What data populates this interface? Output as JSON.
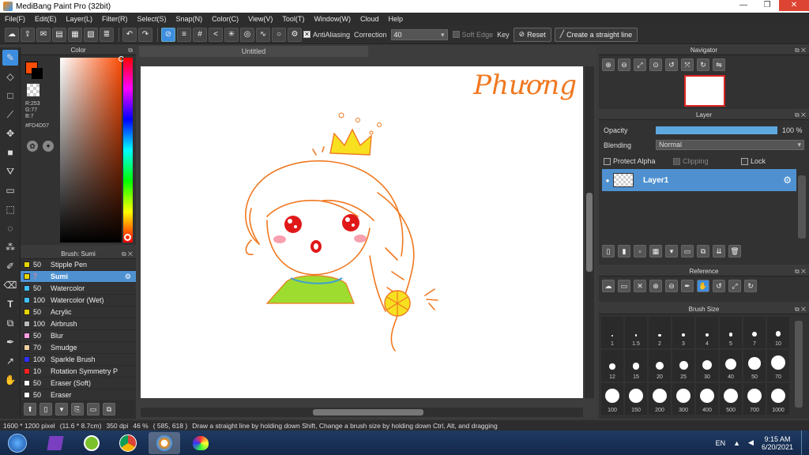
{
  "window": {
    "title": "MediBang Paint Pro (32bit)",
    "min": "—",
    "max": "❐",
    "close": "✕"
  },
  "menu": [
    "File(F)",
    "Edit(E)",
    "Layer(L)",
    "Filter(R)",
    "Select(S)",
    "Snap(N)",
    "Color(C)",
    "View(V)",
    "Tool(T)",
    "Window(W)",
    "Cloud",
    "Help"
  ],
  "toolbar": {
    "antialiasing": "AntiAliasing",
    "correction_label": "Correction",
    "correction_value": "40",
    "soft_edge": "Soft Edge",
    "key": "Key",
    "reset": "Reset",
    "straight_line": "Create a straight line"
  },
  "color_panel": {
    "title": "Color",
    "r": "R:253",
    "g": "G:77",
    "b": "B:7",
    "hex": "#FD4D07",
    "fg": "#FD4D07"
  },
  "brush_panel": {
    "title": "Brush: Sumi",
    "items": [
      {
        "size": "50",
        "name": "Stipple Pen",
        "color": "#e8d400"
      },
      {
        "size": "7",
        "name": "Sumi",
        "color": "#e8d400"
      },
      {
        "size": "50",
        "name": "Watercolor",
        "color": "#40c0ff"
      },
      {
        "size": "100",
        "name": "Watercolor (Wet)",
        "color": "#40c0ff"
      },
      {
        "size": "50",
        "name": "Acrylic",
        "color": "#e8d400"
      },
      {
        "size": "100",
        "name": "Airbrush",
        "color": "#bbbbbb"
      },
      {
        "size": "50",
        "name": "Blur",
        "color": "#ff9de0"
      },
      {
        "size": "70",
        "name": "Smudge",
        "color": "#f0d0a0"
      },
      {
        "size": "100",
        "name": "Sparkle Brush",
        "color": "#3030ff"
      },
      {
        "size": "10",
        "name": "Rotation Symmetry P",
        "color": "#ff2020"
      },
      {
        "size": "50",
        "name": "Eraser (Soft)",
        "color": "#ffffff"
      },
      {
        "size": "50",
        "name": "Eraser",
        "color": "#ffffff"
      }
    ]
  },
  "canvas": {
    "tab": "Untitled",
    "signature": "Phương"
  },
  "navigator": {
    "title": "Navigator"
  },
  "layer_panel": {
    "title": "Layer",
    "opacity_label": "Opacity",
    "opacity_value": "100 %",
    "opacity": 1.0,
    "blending_label": "Blending",
    "blending_value": "Normal",
    "protect_alpha": "Protect Alpha",
    "clipping": "Clipping",
    "lock": "Lock",
    "layer_name": "Layer1"
  },
  "reference": {
    "title": "Reference"
  },
  "brush_size": {
    "title": "Brush Size",
    "sizes": [
      "1",
      "1.5",
      "2",
      "3",
      "4",
      "5",
      "7",
      "10",
      "12",
      "15",
      "20",
      "25",
      "30",
      "40",
      "50",
      "70",
      "100",
      "150",
      "200",
      "300",
      "400",
      "500",
      "700",
      "1000"
    ]
  },
  "status": {
    "dims": "1600 * 1200 pixel",
    "physical": "(11.6 * 8.7cm)",
    "dpi": "350 dpi",
    "zoom": "46 %",
    "coords": "( 585, 618 )",
    "hint": "Draw a straight line by holding down Shift, Change a brush size by holding down Ctrl, Alt, and dragging"
  },
  "taskbar": {
    "lang": "EN",
    "time": "9:15 AM",
    "date": "6/20/2021"
  }
}
